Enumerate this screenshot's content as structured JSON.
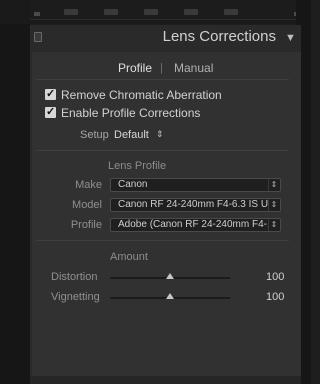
{
  "panel": {
    "title": "Lens Corrections",
    "collapse_icon": "triangle-down-icon"
  },
  "tabs": {
    "profile": "Profile",
    "separator": "|",
    "manual": "Manual"
  },
  "checkboxes": [
    {
      "label": "Remove Chromatic Aberration",
      "checked": true
    },
    {
      "label": "Enable Profile Corrections",
      "checked": true
    }
  ],
  "setup": {
    "label": "Setup",
    "value": "Default",
    "arrows": "⇕"
  },
  "lens_profile": {
    "title": "Lens Profile",
    "fields": [
      {
        "label": "Make",
        "value": "Canon"
      },
      {
        "label": "Model",
        "value": "Canon RF 24-240mm F4-6.3 IS U..."
      },
      {
        "label": "Profile",
        "value": "Adobe (Canon RF 24-240mm F4-..."
      }
    ]
  },
  "amount": {
    "title": "Amount",
    "sliders": [
      {
        "label": "Distortion",
        "value": "100",
        "level": 0.5
      },
      {
        "label": "Vignetting",
        "value": "100",
        "level": 0.5
      }
    ]
  },
  "colors": {
    "panel_bg": "#313131",
    "header_bg": "#2a2a2a",
    "text": "#d0d0d0",
    "muted": "#8f8f8f"
  }
}
